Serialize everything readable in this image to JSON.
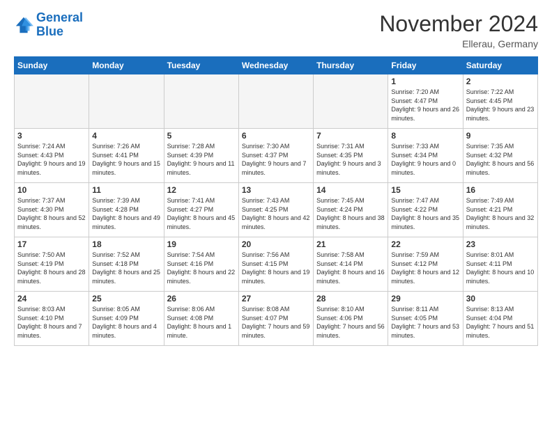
{
  "header": {
    "logo_line1": "General",
    "logo_line2": "Blue",
    "month_title": "November 2024",
    "location": "Ellerau, Germany"
  },
  "weekdays": [
    "Sunday",
    "Monday",
    "Tuesday",
    "Wednesday",
    "Thursday",
    "Friday",
    "Saturday"
  ],
  "weeks": [
    [
      {
        "day": "",
        "info": ""
      },
      {
        "day": "",
        "info": ""
      },
      {
        "day": "",
        "info": ""
      },
      {
        "day": "",
        "info": ""
      },
      {
        "day": "",
        "info": ""
      },
      {
        "day": "1",
        "info": "Sunrise: 7:20 AM\nSunset: 4:47 PM\nDaylight: 9 hours and 26 minutes."
      },
      {
        "day": "2",
        "info": "Sunrise: 7:22 AM\nSunset: 4:45 PM\nDaylight: 9 hours and 23 minutes."
      }
    ],
    [
      {
        "day": "3",
        "info": "Sunrise: 7:24 AM\nSunset: 4:43 PM\nDaylight: 9 hours and 19 minutes."
      },
      {
        "day": "4",
        "info": "Sunrise: 7:26 AM\nSunset: 4:41 PM\nDaylight: 9 hours and 15 minutes."
      },
      {
        "day": "5",
        "info": "Sunrise: 7:28 AM\nSunset: 4:39 PM\nDaylight: 9 hours and 11 minutes."
      },
      {
        "day": "6",
        "info": "Sunrise: 7:30 AM\nSunset: 4:37 PM\nDaylight: 9 hours and 7 minutes."
      },
      {
        "day": "7",
        "info": "Sunrise: 7:31 AM\nSunset: 4:35 PM\nDaylight: 9 hours and 3 minutes."
      },
      {
        "day": "8",
        "info": "Sunrise: 7:33 AM\nSunset: 4:34 PM\nDaylight: 9 hours and 0 minutes."
      },
      {
        "day": "9",
        "info": "Sunrise: 7:35 AM\nSunset: 4:32 PM\nDaylight: 8 hours and 56 minutes."
      }
    ],
    [
      {
        "day": "10",
        "info": "Sunrise: 7:37 AM\nSunset: 4:30 PM\nDaylight: 8 hours and 52 minutes."
      },
      {
        "day": "11",
        "info": "Sunrise: 7:39 AM\nSunset: 4:28 PM\nDaylight: 8 hours and 49 minutes."
      },
      {
        "day": "12",
        "info": "Sunrise: 7:41 AM\nSunset: 4:27 PM\nDaylight: 8 hours and 45 minutes."
      },
      {
        "day": "13",
        "info": "Sunrise: 7:43 AM\nSunset: 4:25 PM\nDaylight: 8 hours and 42 minutes."
      },
      {
        "day": "14",
        "info": "Sunrise: 7:45 AM\nSunset: 4:24 PM\nDaylight: 8 hours and 38 minutes."
      },
      {
        "day": "15",
        "info": "Sunrise: 7:47 AM\nSunset: 4:22 PM\nDaylight: 8 hours and 35 minutes."
      },
      {
        "day": "16",
        "info": "Sunrise: 7:49 AM\nSunset: 4:21 PM\nDaylight: 8 hours and 32 minutes."
      }
    ],
    [
      {
        "day": "17",
        "info": "Sunrise: 7:50 AM\nSunset: 4:19 PM\nDaylight: 8 hours and 28 minutes."
      },
      {
        "day": "18",
        "info": "Sunrise: 7:52 AM\nSunset: 4:18 PM\nDaylight: 8 hours and 25 minutes."
      },
      {
        "day": "19",
        "info": "Sunrise: 7:54 AM\nSunset: 4:16 PM\nDaylight: 8 hours and 22 minutes."
      },
      {
        "day": "20",
        "info": "Sunrise: 7:56 AM\nSunset: 4:15 PM\nDaylight: 8 hours and 19 minutes."
      },
      {
        "day": "21",
        "info": "Sunrise: 7:58 AM\nSunset: 4:14 PM\nDaylight: 8 hours and 16 minutes."
      },
      {
        "day": "22",
        "info": "Sunrise: 7:59 AM\nSunset: 4:12 PM\nDaylight: 8 hours and 12 minutes."
      },
      {
        "day": "23",
        "info": "Sunrise: 8:01 AM\nSunset: 4:11 PM\nDaylight: 8 hours and 10 minutes."
      }
    ],
    [
      {
        "day": "24",
        "info": "Sunrise: 8:03 AM\nSunset: 4:10 PM\nDaylight: 8 hours and 7 minutes."
      },
      {
        "day": "25",
        "info": "Sunrise: 8:05 AM\nSunset: 4:09 PM\nDaylight: 8 hours and 4 minutes."
      },
      {
        "day": "26",
        "info": "Sunrise: 8:06 AM\nSunset: 4:08 PM\nDaylight: 8 hours and 1 minute."
      },
      {
        "day": "27",
        "info": "Sunrise: 8:08 AM\nSunset: 4:07 PM\nDaylight: 7 hours and 59 minutes."
      },
      {
        "day": "28",
        "info": "Sunrise: 8:10 AM\nSunset: 4:06 PM\nDaylight: 7 hours and 56 minutes."
      },
      {
        "day": "29",
        "info": "Sunrise: 8:11 AM\nSunset: 4:05 PM\nDaylight: 7 hours and 53 minutes."
      },
      {
        "day": "30",
        "info": "Sunrise: 8:13 AM\nSunset: 4:04 PM\nDaylight: 7 hours and 51 minutes."
      }
    ]
  ]
}
